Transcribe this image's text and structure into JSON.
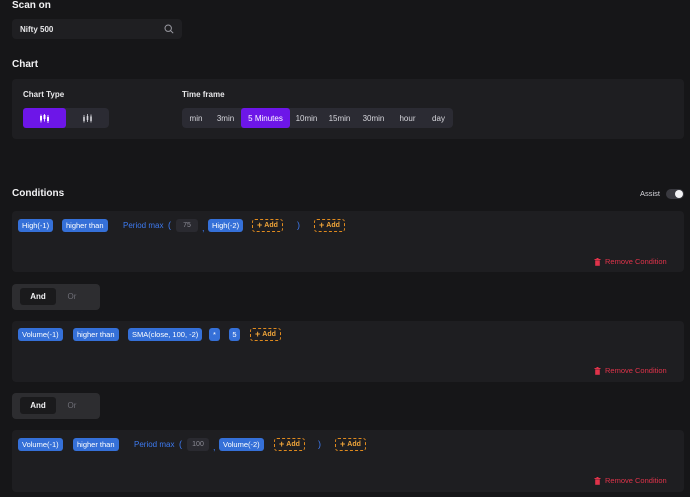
{
  "scan_on": {
    "title": "Scan on",
    "search_value": "Nifty 500",
    "icon": "search-icon"
  },
  "chart": {
    "title": "Chart",
    "chart_type_label": "Chart Type",
    "chart_types": [
      {
        "icon": "candlestick-icon",
        "active": true
      },
      {
        "icon": "ohlc-bars-icon",
        "active": false
      }
    ],
    "time_frame_label": "Time frame",
    "time_frames": [
      "min",
      "3min",
      "5 Minutes",
      "10min",
      "15min",
      "30min",
      "hour",
      "day"
    ],
    "active_time_frame": "5 Minutes"
  },
  "conditions": {
    "title": "Conditions",
    "assist_label": "Assist",
    "assist_on": false,
    "remove_label": "Remove Condition",
    "add_label": "Add",
    "items": [
      {
        "left": "High(-1)",
        "operator": "higher than",
        "func": "Period max",
        "open_paren": "(",
        "period": "75",
        "comma": ",",
        "arg": "High(-2)",
        "close_paren": ")"
      },
      {
        "left": "Volume(-1)",
        "operator": "higher than",
        "func_chip": "SMA(close, 100, -2)",
        "mult": "*",
        "factor": "5"
      },
      {
        "left": "Volume(-1)",
        "operator": "higher than",
        "func": "Period max",
        "open_paren": "(",
        "period": "100",
        "comma": ",",
        "arg": "Volume(-2)",
        "close_paren": ")"
      }
    ],
    "joiners": [
      {
        "options": [
          "And",
          "Or"
        ],
        "selected": "And"
      },
      {
        "options": [
          "And",
          "Or"
        ],
        "selected": "And"
      }
    ]
  },
  "colors": {
    "background": "#161618",
    "accent_purple": "#6d16e8",
    "chip_blue": "#3570d8",
    "add_orange": "#e08a1e",
    "remove_red": "#e0334a"
  }
}
